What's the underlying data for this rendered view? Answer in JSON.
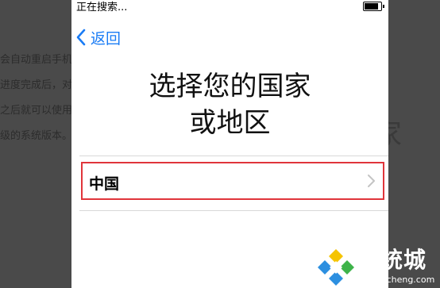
{
  "background": {
    "lines": [
      "会自动重启手机",
      "进度完成后，对",
      "之后就可以使用",
      "级的系统版本。"
    ],
    "right_char": "家"
  },
  "status_bar": {
    "text": "正在搜索...",
    "battery_level": 0.85
  },
  "nav": {
    "back_label": "返回",
    "accent": "#1a7cf5"
  },
  "screen": {
    "title_line1": "选择您的国家",
    "title_line2": "或地区"
  },
  "country_list": {
    "items": [
      {
        "label": "中国"
      }
    ],
    "highlight_color": "#e0353b"
  },
  "watermark": {
    "name": "系统城",
    "url": "xitongcheng.com"
  }
}
